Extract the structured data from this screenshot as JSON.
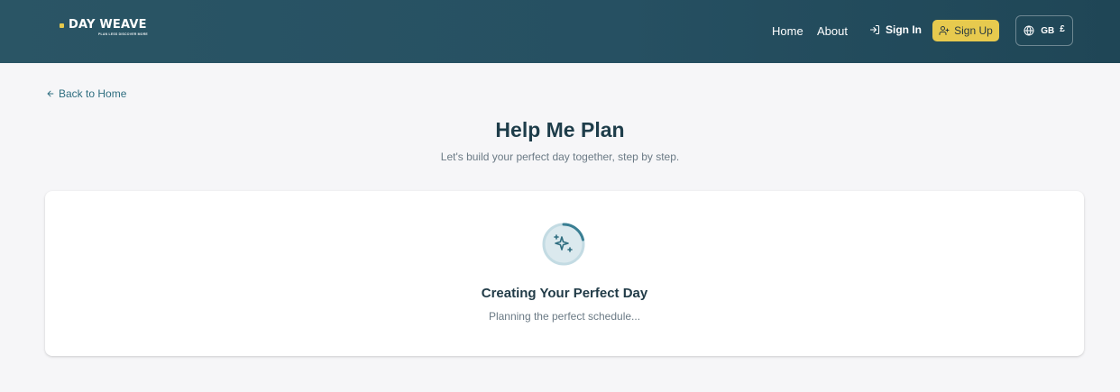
{
  "brand": {
    "name": "DAY WEAVE",
    "tagline": "PLAN LESS DISCOVER MORE",
    "accent_color": "#e7c94c"
  },
  "nav": {
    "links": [
      {
        "label": "Home"
      },
      {
        "label": "About"
      }
    ],
    "sign_in": {
      "label": "Sign In",
      "icon": "sign-in-icon"
    },
    "sign_up": {
      "label": "Sign Up",
      "icon": "user-plus-icon"
    },
    "region": {
      "country": "GB",
      "currency": "£",
      "icon": "globe-icon"
    }
  },
  "back_link": {
    "label": "Back to Home",
    "icon": "arrow-left-icon"
  },
  "page": {
    "title": "Help Me Plan",
    "subtitle": "Let's build your perfect day together, step by step."
  },
  "loading": {
    "title": "Creating Your Perfect Day",
    "status": "Planning the perfect schedule...",
    "icon": "sparkles-icon"
  },
  "colors": {
    "header_bg": "#275263",
    "primary_text": "#1e3d4a",
    "link": "#2f6e80",
    "button_yellow": "#e7ca4e",
    "page_bg": "#f6f6f8"
  }
}
